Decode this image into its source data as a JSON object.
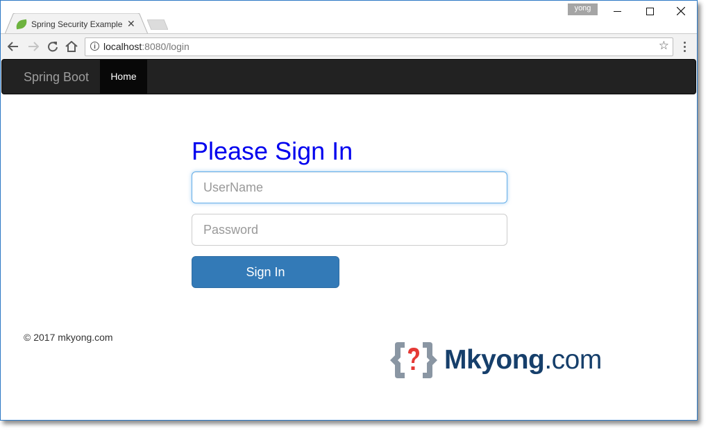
{
  "browser": {
    "tab_title": "Spring Security Example",
    "profile_name": "yong",
    "url_host": "localhost",
    "url_rest": ":8080/login"
  },
  "icons": {
    "back": "arrow-left",
    "forward": "arrow-right",
    "reload": "reload",
    "home": "home",
    "info": "info",
    "bookmark": "star",
    "menu": "vertical-dots",
    "minimize": "minimize",
    "maximize": "maximize",
    "close": "close"
  },
  "navbar": {
    "brand": "Spring Boot",
    "items": [
      {
        "label": "Home",
        "active": true
      }
    ]
  },
  "login": {
    "heading": "Please Sign In",
    "username_placeholder": "UserName",
    "username_value": "",
    "password_placeholder": "Password",
    "password_value": "",
    "submit_label": "Sign In"
  },
  "footer": {
    "copyright": "© 2017 mkyong.com"
  },
  "logo": {
    "name": "Mkyong",
    "domain": ".com"
  },
  "colors": {
    "heading": "#0000ee",
    "primary": "#337ab7",
    "navbar": "#222222",
    "logo_text": "#163f6b",
    "logo_accent": "#e53935",
    "logo_bracket": "#8a96a3"
  }
}
